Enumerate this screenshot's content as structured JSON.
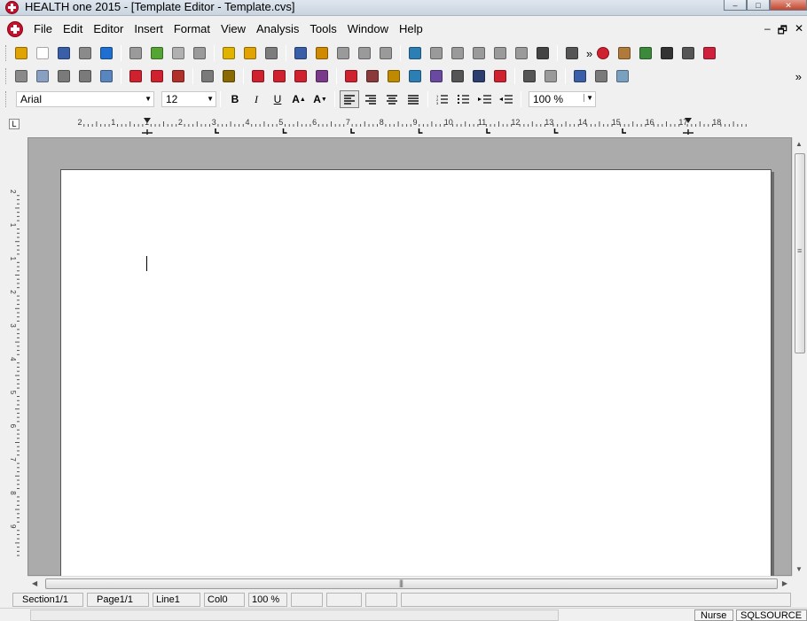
{
  "window": {
    "title": "HEALTH one 2015 - [Template Editor - Template.cvs]",
    "controls": {
      "minimize": "–",
      "maximize": "□",
      "close": "✕"
    }
  },
  "menubar": {
    "items": [
      "File",
      "Edit",
      "Editor",
      "Insert",
      "Format",
      "View",
      "Analysis",
      "Tools",
      "Window",
      "Help"
    ],
    "mdi_controls": {
      "minimize": "–",
      "restore": "🗗",
      "close": "✕"
    }
  },
  "toolbar1": {
    "icons": [
      {
        "name": "open-folder-icon",
        "color": "#e0a400"
      },
      {
        "name": "new-document-icon",
        "color": "#ffffff"
      },
      {
        "name": "save-icon",
        "color": "#3a5fa8"
      },
      {
        "name": "print-icon",
        "color": "#8a8a8a"
      },
      {
        "name": "help-icon",
        "color": "#1f6fd1"
      },
      {
        "name": "document-list-icon",
        "color": "#9a9a9a"
      },
      {
        "name": "import-icon",
        "color": "#54a534"
      },
      {
        "name": "export-icon",
        "color": "#b0b0b0"
      },
      {
        "name": "notes-icon",
        "color": "#9a9a9a"
      },
      {
        "name": "mail-open-icon",
        "color": "#e0b300"
      },
      {
        "name": "refresh-icon",
        "color": "#e2a200"
      },
      {
        "name": "card-icon",
        "color": "#7c7c7c"
      },
      {
        "name": "table-icon",
        "color": "#3a5fa8"
      },
      {
        "name": "people-icon",
        "color": "#d08a00"
      },
      {
        "name": "nb-icon",
        "color": "#9a9a9a"
      },
      {
        "name": "grid-icon",
        "color": "#9a9a9a"
      },
      {
        "name": "chart-icon",
        "color": "#9a9a9a"
      },
      {
        "name": "form-icon",
        "color": "#2b7fb5"
      },
      {
        "name": "stethoscope-icon",
        "color": "#9a9a9a"
      },
      {
        "name": "stethoscope2-icon",
        "color": "#9a9a9a"
      },
      {
        "name": "stethoscope3-icon",
        "color": "#9a9a9a"
      },
      {
        "name": "stethoscope4-icon",
        "color": "#9a9a9a"
      },
      {
        "name": "stethoscope5-icon",
        "color": "#9a9a9a"
      },
      {
        "name": "binoculars-icon",
        "color": "#444444"
      },
      {
        "name": "clipboard-icon",
        "color": "#555555"
      }
    ],
    "overflow": "»",
    "right_icons": [
      {
        "name": "stop-icon",
        "color": "#d0212f"
      },
      {
        "name": "package-icon",
        "color": "#b07a3a"
      },
      {
        "name": "users-icon",
        "color": "#3c8a3c"
      },
      {
        "name": "eye-icon",
        "color": "#333333"
      },
      {
        "name": "archive-icon",
        "color": "#555555"
      },
      {
        "name": "heart-icon",
        "color": "#d0213c"
      }
    ]
  },
  "toolbar2": {
    "icons": [
      {
        "name": "trash-icon",
        "color": "#8a8a8a"
      },
      {
        "name": "envelope-icon",
        "color": "#8aa0c0"
      },
      {
        "name": "fax-icon",
        "color": "#7a7a7a"
      },
      {
        "name": "bracket-icon",
        "color": "#7a7a7a"
      },
      {
        "name": "image-icon",
        "color": "#5a86c0"
      },
      {
        "name": "arrow-right-icon",
        "color": "#d0212f"
      },
      {
        "name": "export-red-icon",
        "color": "#d0212f"
      },
      {
        "name": "paste-icon",
        "color": "#b0302a"
      },
      {
        "name": "preview-icon",
        "color": "#7a7a7a"
      },
      {
        "name": "edit-field-icon",
        "color": "#8a6a00"
      },
      {
        "name": "parentheses-icon",
        "color": "#d0212f"
      },
      {
        "name": "bracket-field-icon",
        "color": "#d0212f"
      },
      {
        "name": "list-field-icon",
        "color": "#d0212f"
      },
      {
        "name": "calendar-icon",
        "color": "#7a3a8a"
      },
      {
        "name": "question-field-icon",
        "color": "#d0212f"
      },
      {
        "name": "person-icon",
        "color": "#8a3a3a"
      },
      {
        "name": "tools-icon",
        "color": "#c08a00"
      },
      {
        "name": "lab-icon",
        "color": "#2b7fb5"
      },
      {
        "name": "graph-icon",
        "color": "#6a4aa0"
      },
      {
        "name": "keyboard-icon",
        "color": "#555555"
      },
      {
        "name": "puzzle-icon",
        "color": "#2c3e70"
      },
      {
        "name": "medical-cross-icon",
        "color": "#d0212f"
      },
      {
        "name": "network-icon",
        "color": "#555555"
      },
      {
        "name": "form-template-icon",
        "color": "#9a9a9a"
      },
      {
        "name": "doc-sheet-icon",
        "color": "#3a5fa8"
      },
      {
        "name": "copy-doc-icon",
        "color": "#7a7a7a"
      },
      {
        "name": "transfer-icon",
        "color": "#7aa0c0"
      }
    ],
    "overflow": "»"
  },
  "format_bar": {
    "font": "Arial",
    "size": "12",
    "bold": "B",
    "italic": "I",
    "underline": "U",
    "grow_font": "A",
    "shrink_font": "A",
    "zoom": "100 %"
  },
  "ruler": {
    "corner": "L",
    "h_labels": [
      "2",
      "1",
      "1",
      "2",
      "3",
      "4",
      "5",
      "6",
      "7",
      "8",
      "9",
      "10",
      "11",
      "12",
      "13",
      "14",
      "15",
      "16",
      "17",
      "18"
    ],
    "v_labels": [
      "2",
      "1",
      "1",
      "2",
      "3",
      "4",
      "5",
      "6",
      "7",
      "8",
      "9"
    ]
  },
  "statusbar": {
    "section": "Section1/1",
    "page": "Page1/1",
    "line": "Line1",
    "col": "Col0",
    "zoom": "100 %"
  },
  "statusbar2": {
    "user": "Nurse",
    "database": "SQLSOURCE"
  }
}
